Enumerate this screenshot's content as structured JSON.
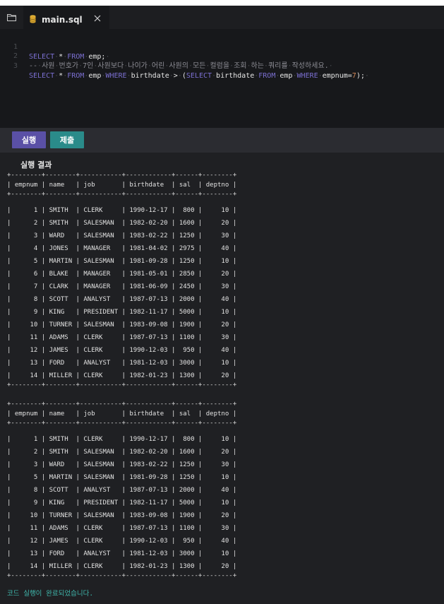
{
  "tab": {
    "file_name": "main.sql",
    "file_icon": "database-icon",
    "close_icon": "close-icon"
  },
  "sidebar": {
    "icon": "folder-icon"
  },
  "editor": {
    "lines": [
      {
        "number": "1",
        "text": "SELECT·*·FROM·emp;·"
      },
      {
        "number": "2",
        "text": "--·사원·번호가·7인·사원보다·나이가·어린·사원의·모든·컬럼을·조회·하는·쿼리를·작성하세요.·"
      },
      {
        "number": "3",
        "text": "SELECT·*·FROM·emp·WHERE·birthdate·>·(SELECT·birthdate·FROM·emp·WHERE·empnum=7);·"
      }
    ]
  },
  "toolbar": {
    "run_label": "실행",
    "submit_label": "제출"
  },
  "result": {
    "title": "실행 결과",
    "separator": "+--------+--------+-----------+------------+------+--------+",
    "header": "| empnum | name   | job       | birthdate  | sal  | deptno |",
    "table1": [
      "|      1 | SMITH  | CLERK     | 1990-12-17 |  800 |     10 |",
      "|      2 | SMITH  | SALESMAN  | 1982-02-20 | 1600 |     20 |",
      "|      3 | WARD   | SALESMAN  | 1983-02-22 | 1250 |     30 |",
      "|      4 | JONES  | MANAGER   | 1981-04-02 | 2975 |     40 |",
      "|      5 | MARTIN | SALESMAN  | 1981-09-28 | 1250 |     10 |",
      "|      6 | BLAKE  | MANAGER   | 1981-05-01 | 2850 |     20 |",
      "|      7 | CLARK  | MANAGER   | 1981-06-09 | 2450 |     30 |",
      "|      8 | SCOTT  | ANALYST   | 1987-07-13 | 2000 |     40 |",
      "|      9 | KING   | PRESIDENT | 1982-11-17 | 5000 |     10 |",
      "|     10 | TURNER | SALESMAN  | 1983-09-08 | 1900 |     20 |",
      "|     11 | ADAMS  | CLERK     | 1987-07-13 | 1100 |     30 |",
      "|     12 | JAMES  | CLERK     | 1990-12-03 |  950 |     40 |",
      "|     13 | FORD   | ANALYST   | 1981-12-03 | 3000 |     10 |",
      "|     14 | MILLER | CLERK     | 1982-01-23 | 1300 |     20 |"
    ],
    "table2": [
      "|      1 | SMITH  | CLERK     | 1990-12-17 |  800 |     10 |",
      "|      2 | SMITH  | SALESMAN  | 1982-02-20 | 1600 |     20 |",
      "|      3 | WARD   | SALESMAN  | 1983-02-22 | 1250 |     30 |",
      "|      5 | MARTIN | SALESMAN  | 1981-09-28 | 1250 |     10 |",
      "|      8 | SCOTT  | ANALYST   | 1987-07-13 | 2000 |     40 |",
      "|      9 | KING   | PRESIDENT | 1982-11-17 | 5000 |     10 |",
      "|     10 | TURNER | SALESMAN  | 1983-09-08 | 1900 |     20 |",
      "|     11 | ADAMS  | CLERK     | 1987-07-13 | 1100 |     30 |",
      "|     12 | JAMES  | CLERK     | 1990-12-03 |  950 |     40 |",
      "|     13 | FORD   | ANALYST   | 1981-12-03 | 3000 |     10 |",
      "|     14 | MILLER | CLERK     | 1982-01-23 | 1300 |     20 |"
    ],
    "status": "코드 실행이 완료되었습니다."
  },
  "colors": {
    "run_button": "#5a50a6",
    "submit_button": "#2a8b8a",
    "keyword": "#7b6fd1",
    "status": "#3fb8ad"
  }
}
